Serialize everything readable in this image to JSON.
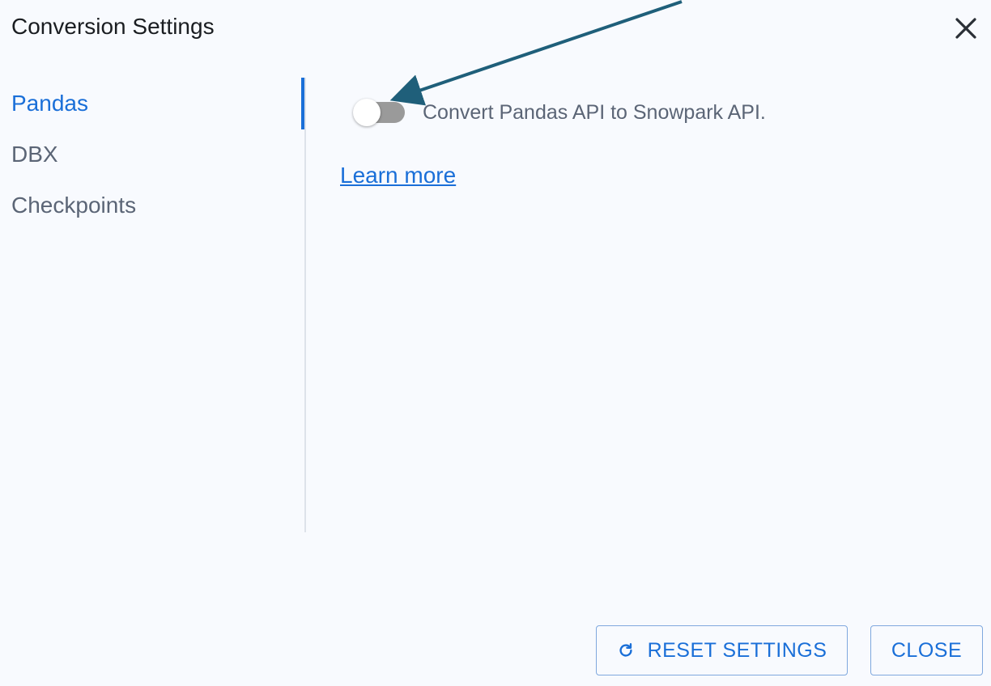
{
  "dialog": {
    "title": "Conversion Settings"
  },
  "sidebar": {
    "items": [
      {
        "label": "Pandas",
        "active": true
      },
      {
        "label": "DBX",
        "active": false
      },
      {
        "label": "Checkpoints",
        "active": false
      }
    ]
  },
  "pandas_panel": {
    "toggle_label": "Convert Pandas API to Snowpark API.",
    "toggle_on": false,
    "learn_more": "Learn more"
  },
  "footer": {
    "reset_label": "RESET SETTINGS",
    "reset_icon": "refresh-icon",
    "close_label": "CLOSE"
  },
  "colors": {
    "accent": "#1a6fd8",
    "annotation_arrow": "#1f5f7a",
    "toggle_track": "#9a9a9a"
  }
}
